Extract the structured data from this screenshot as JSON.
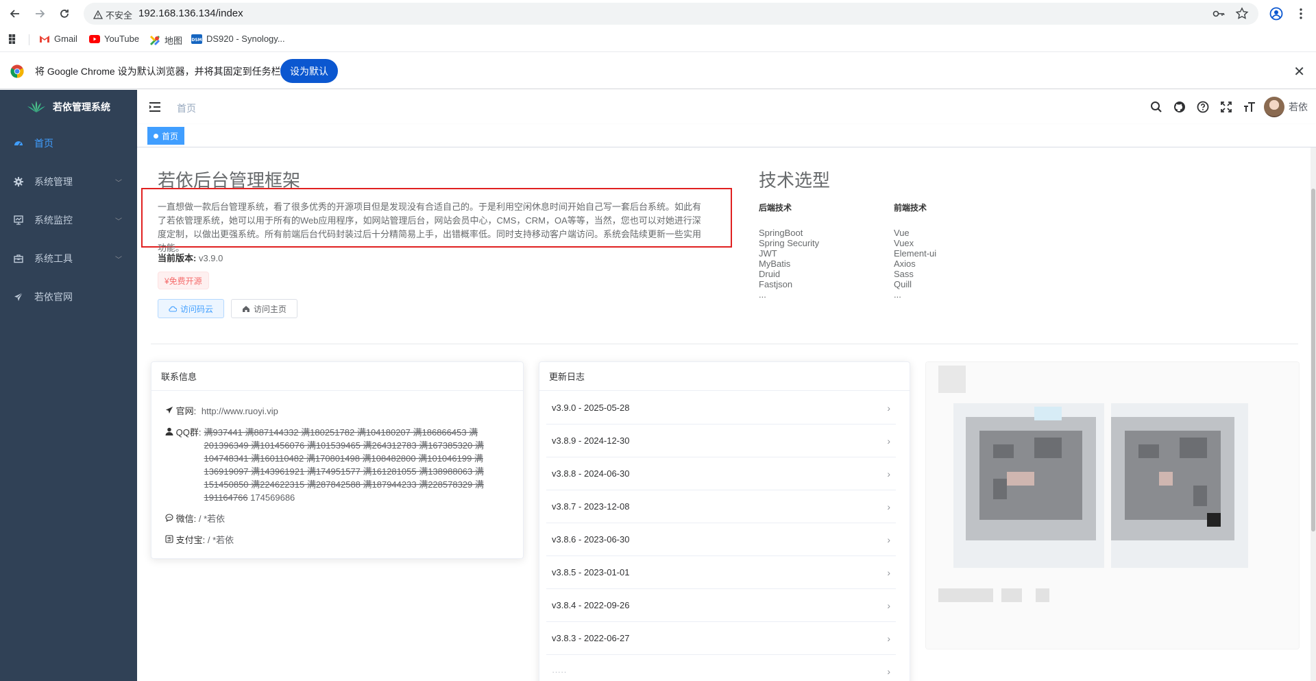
{
  "browser": {
    "security_label": "不安全",
    "url": "192.168.136.134/index",
    "bookmarks": [
      "Gmail",
      "YouTube",
      "地图",
      "DS920 - Synology..."
    ],
    "infobar_message": "将 Google Chrome 设为默认浏览器，并将其固定到任务栏",
    "infobar_button": "设为默认"
  },
  "sidebar": {
    "logo_text": "若依管理系统",
    "items": [
      {
        "label": "首页",
        "icon": "dashboard-icon"
      },
      {
        "label": "系统管理",
        "icon": "gear-icon"
      },
      {
        "label": "系统监控",
        "icon": "monitor-icon"
      },
      {
        "label": "系统工具",
        "icon": "toolbox-icon"
      },
      {
        "label": "若依官网",
        "icon": "send-icon"
      }
    ]
  },
  "navbar": {
    "breadcrumb": "首页",
    "username": "若依"
  },
  "tags": {
    "active": "首页"
  },
  "main": {
    "title": "若依后台管理框架",
    "intro": "一直想做一款后台管理系统，看了很多优秀的开源项目但是发现没有合适自己的。于是利用空闲休息时间开始自己写一套后台系统。如此有了若依管理系统，她可以用于所有的Web应用程序，如网站管理后台，网站会员中心，CMS，CRM，OA等等，当然，您也可以对她进行深度定制，以做出更强系统。所有前端后台代码封装过后十分精简易上手，出错概率低。同时支持移动客户端访问。系统会陆续更新一些实用功能。",
    "version_label": "当前版本:",
    "version_value": "v3.9.0",
    "free_tag": "¥免费开源",
    "btn_cloud": "访问码云",
    "btn_home": "访问主页",
    "tech_title": "技术选型",
    "backend_title": "后端技术",
    "backend": [
      "SpringBoot",
      "Spring Security",
      "JWT",
      "MyBatis",
      "Druid",
      "Fastjson",
      "..."
    ],
    "frontend_title": "前端技术",
    "frontend": [
      "Vue",
      "Vuex",
      "Element-ui",
      "Axios",
      "Sass",
      "Quill",
      "..."
    ]
  },
  "contact": {
    "title": "联系信息",
    "site_label": "官网:",
    "site_value": "http://www.ruoyi.vip",
    "qq_label": "QQ群:",
    "qq_struck": "满937441 满887144332 满180251782 满104180207 满186866453 满201396349 满101456076 满101539465 满264312783 满167385320 满104748341 满160110482 满170801498 满108482800 满101046199 满136919097 满143961921 满174951577 满161281055 满138988063 满151450850 满224622315 满287842588 满187944233 满228578329 满191164766",
    "qq_open": "174569686",
    "wechat_label": "微信:",
    "wechat_value": "/ *若依",
    "alipay_label": "支付宝:",
    "alipay_value": "/ *若依"
  },
  "changelog": {
    "title": "更新日志",
    "items": [
      "v3.9.0 - 2025-05-28",
      "v3.8.9 - 2024-12-30",
      "v3.8.8 - 2024-06-30",
      "v3.8.7 - 2023-12-08",
      "v3.8.6 - 2023-06-30",
      "v3.8.5 - 2023-01-01",
      "v3.8.4 - 2022-09-26",
      "v3.8.3 - 2022-06-27"
    ]
  }
}
